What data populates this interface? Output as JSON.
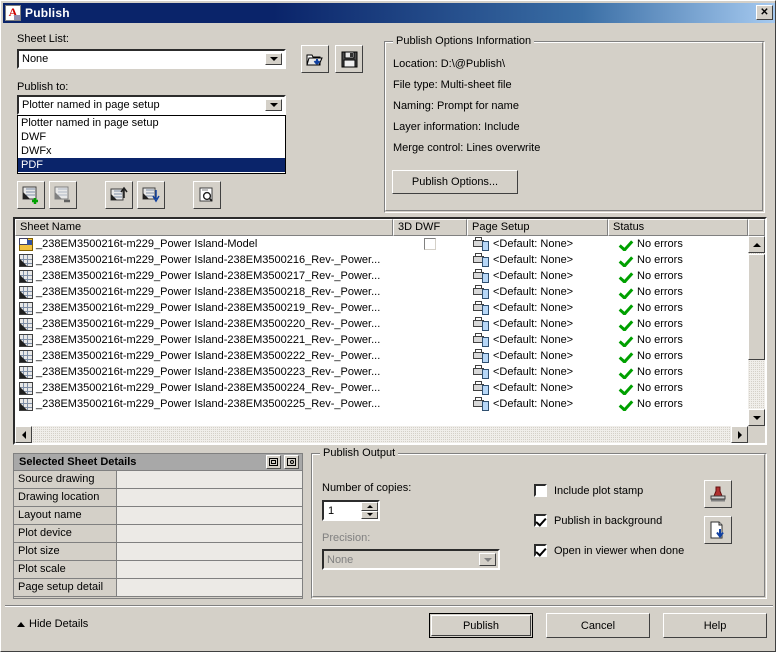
{
  "window": {
    "title": "Publish",
    "icon": "autocad-a-icon",
    "close_label": "✕"
  },
  "sheet_list": {
    "label": "Sheet List:",
    "value": "None",
    "load_icon": "open-folder-icon",
    "save_icon": "floppy-save-icon"
  },
  "publish_to": {
    "label": "Publish to:",
    "value": "Plotter named in page setup",
    "options": [
      "Plotter named in page setup",
      "DWF",
      "DWFx",
      "PDF"
    ],
    "selected_index": 3
  },
  "sheet_toolbar": [
    {
      "name": "add-sheets-button",
      "icon": "add-sheets-icon"
    },
    {
      "name": "remove-sheets-button",
      "icon": "remove-sheets-icon"
    },
    {
      "name": "move-sheet-up-button",
      "icon": "move-up-icon"
    },
    {
      "name": "move-sheet-down-button",
      "icon": "move-down-icon"
    },
    {
      "name": "preview-button",
      "icon": "preview-magnifier-icon"
    }
  ],
  "options_info": {
    "title": "Publish Options Information",
    "lines": [
      "Location: D:\\@Publish\\",
      "File type: Multi-sheet file",
      "Naming: Prompt for name",
      "Layer information: Include",
      "Merge control: Lines overwrite"
    ],
    "button_label": "Publish Options..."
  },
  "sheet_table": {
    "columns": [
      "Sheet Name",
      "3D DWF",
      "Page Setup",
      "Status"
    ],
    "rows": [
      {
        "name": "_238EM3500216t-m229_Power Island-Model",
        "icon": "model-tab-icon",
        "dwf_checkbox": true,
        "page_setup": "<Default: None>",
        "status": "No errors"
      },
      {
        "name": "_238EM3500216t-m229_Power Island-238EM3500216_Rev-_Power...",
        "icon": "layout-tab-icon",
        "dwf_checkbox": false,
        "page_setup": "<Default: None>",
        "status": "No errors"
      },
      {
        "name": "_238EM3500216t-m229_Power Island-238EM3500217_Rev-_Power...",
        "icon": "layout-tab-icon",
        "dwf_checkbox": false,
        "page_setup": "<Default: None>",
        "status": "No errors"
      },
      {
        "name": "_238EM3500216t-m229_Power Island-238EM3500218_Rev-_Power...",
        "icon": "layout-tab-icon",
        "dwf_checkbox": false,
        "page_setup": "<Default: None>",
        "status": "No errors"
      },
      {
        "name": "_238EM3500216t-m229_Power Island-238EM3500219_Rev-_Power...",
        "icon": "layout-tab-icon",
        "dwf_checkbox": false,
        "page_setup": "<Default: None>",
        "status": "No errors"
      },
      {
        "name": "_238EM3500216t-m229_Power Island-238EM3500220_Rev-_Power...",
        "icon": "layout-tab-icon",
        "dwf_checkbox": false,
        "page_setup": "<Default: None>",
        "status": "No errors"
      },
      {
        "name": "_238EM3500216t-m229_Power Island-238EM3500221_Rev-_Power...",
        "icon": "layout-tab-icon",
        "dwf_checkbox": false,
        "page_setup": "<Default: None>",
        "status": "No errors"
      },
      {
        "name": "_238EM3500216t-m229_Power Island-238EM3500222_Rev-_Power...",
        "icon": "layout-tab-icon",
        "dwf_checkbox": false,
        "page_setup": "<Default: None>",
        "status": "No errors"
      },
      {
        "name": "_238EM3500216t-m229_Power Island-238EM3500223_Rev-_Power...",
        "icon": "layout-tab-icon",
        "dwf_checkbox": false,
        "page_setup": "<Default: None>",
        "status": "No errors"
      },
      {
        "name": "_238EM3500216t-m229_Power Island-238EM3500224_Rev-_Power...",
        "icon": "layout-tab-icon",
        "dwf_checkbox": false,
        "page_setup": "<Default: None>",
        "status": "No errors"
      },
      {
        "name": "_238EM3500216t-m229_Power Island-238EM3500225_Rev-_Power...",
        "icon": "layout-tab-icon",
        "dwf_checkbox": false,
        "page_setup": "<Default: None>",
        "status": "No errors"
      }
    ]
  },
  "details": {
    "title": "Selected Sheet Details",
    "header_buttons": [
      {
        "name": "details-expand-button",
        "icon": "panel-icon"
      },
      {
        "name": "details-preview-button",
        "icon": "preview-icon"
      }
    ],
    "fields": [
      {
        "key": "Source drawing",
        "value": ""
      },
      {
        "key": "Drawing location",
        "value": ""
      },
      {
        "key": "Layout name",
        "value": ""
      },
      {
        "key": "Plot device",
        "value": ""
      },
      {
        "key": "Plot size",
        "value": ""
      },
      {
        "key": "Plot scale",
        "value": ""
      },
      {
        "key": "Page setup detail",
        "value": ""
      }
    ]
  },
  "publish_output": {
    "title": "Publish Output",
    "copies_label": "Number of copies:",
    "copies_value": "1",
    "precision_label": "Precision:",
    "precision_value": "None",
    "precision_disabled": true,
    "checkboxes": [
      {
        "label": "Include plot stamp",
        "checked": false,
        "name": "include-plot-stamp-checkbox"
      },
      {
        "label": "Publish in background",
        "checked": true,
        "name": "publish-in-background-checkbox"
      },
      {
        "label": "Open in viewer when done",
        "checked": true,
        "name": "open-in-viewer-checkbox"
      }
    ],
    "side_buttons": [
      {
        "name": "plot-stamp-settings-button",
        "icon": "stamp-icon"
      },
      {
        "name": "plot-to-file-button",
        "icon": "page-download-icon"
      }
    ]
  },
  "footer": {
    "hide_details_label": "Hide Details",
    "hide_details_icon": "triangle-up-icon",
    "buttons": [
      {
        "label": "Publish",
        "name": "publish-button",
        "default": true
      },
      {
        "label": "Cancel",
        "name": "cancel-button",
        "default": false
      },
      {
        "label": "Help",
        "name": "help-button",
        "default": false
      }
    ]
  },
  "colors": {
    "dialog_face": "#d4d0c8",
    "title_active": "#0a246a",
    "selection": "#0a246a",
    "status_ok": "#00a000"
  }
}
